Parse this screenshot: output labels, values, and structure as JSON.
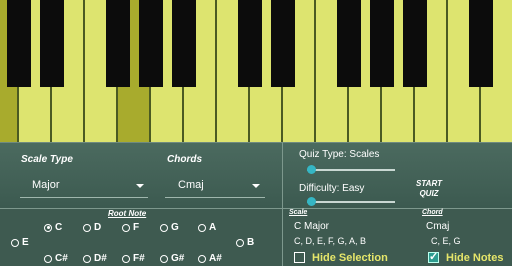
{
  "keyboard": {
    "white_keys": 16,
    "selected_white_keys": [
      0,
      4
    ],
    "black_key_positions": [
      1,
      2,
      4,
      5,
      6,
      8,
      9,
      11,
      12,
      13,
      15
    ]
  },
  "settings": {
    "scale_type_label": "Scale Type",
    "chords_label": "Chords",
    "scale_type_value": "Major",
    "chords_value": "Cmaj"
  },
  "quiz": {
    "quiz_type_label": "Quiz Type: Scales",
    "quiz_type_level": 0.05,
    "difficulty_label": "Difficulty: Easy",
    "difficulty_level": 0.05,
    "start_label_1": "START",
    "start_label_2": "QUIZ"
  },
  "roots": {
    "title": "Root Note",
    "row1": [
      "C",
      "D",
      "F",
      "G",
      "A"
    ],
    "row2": [
      "E",
      "B"
    ],
    "row3": [
      "C#",
      "D#",
      "F#",
      "G#",
      "A#"
    ],
    "selected": "C"
  },
  "info": {
    "scale_header": "Scale",
    "chord_header": "Chord",
    "scale_name": "C Major",
    "scale_notes": "C, D, E, F, G, A, B",
    "chord_name": "Cmaj",
    "chord_notes": "C, E, G",
    "hide_selection_label": "Hide Selection",
    "hide_notes_label": "Hide Notes",
    "hide_selection_checked": false,
    "hide_notes_checked": true
  }
}
